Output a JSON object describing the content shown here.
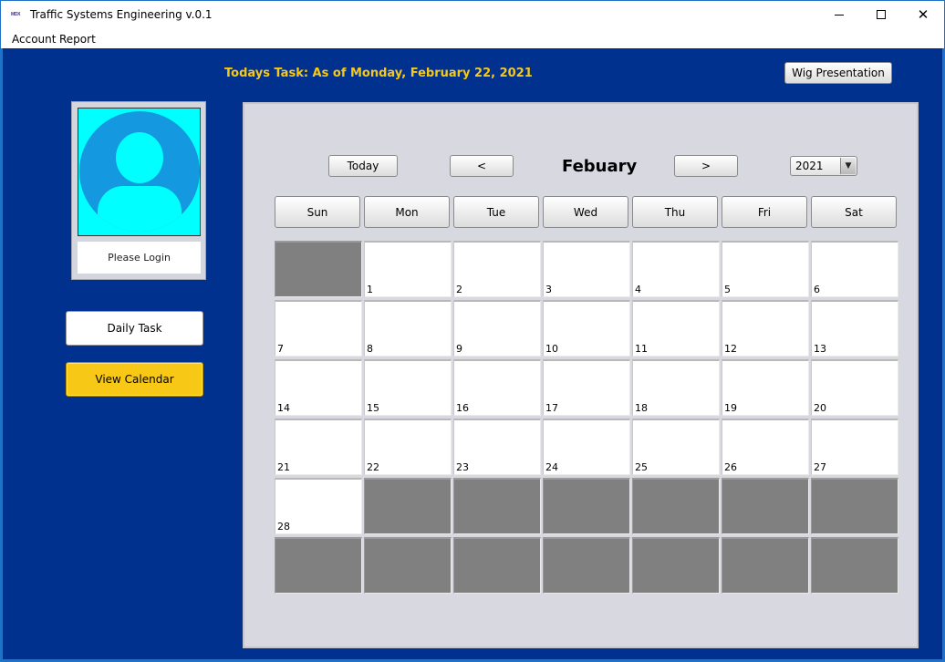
{
  "window": {
    "title": "Traffic Systems Engineering v.0.1",
    "icon_label": "MDX",
    "minimize_icon": "minimize-icon",
    "maximize_icon": "maximize-icon",
    "close_icon": "close-icon",
    "close_glyph": "✕"
  },
  "menu": {
    "items": [
      "Account",
      "Report"
    ]
  },
  "header": {
    "today_task": "Todays Task: As of Monday, February 22, 2021",
    "wig_button": "Wig Presentation"
  },
  "profile": {
    "avatar_icon": "user-avatar-icon",
    "login_text": "Please Login"
  },
  "sidebar": {
    "daily_task": "Daily Task",
    "view_calendar": "View Calendar"
  },
  "calendar": {
    "today_label": "Today",
    "prev_label": "<",
    "next_label": ">",
    "month": "Febuary",
    "year": "2021",
    "year_arrow": "▼",
    "weekdays": [
      "Sun",
      "Mon",
      "Tue",
      "Wed",
      "Thu",
      "Fri",
      "Sat"
    ],
    "days": [
      "",
      "1",
      "2",
      "3",
      "4",
      "5",
      "6",
      "7",
      "8",
      "9",
      "10",
      "11",
      "12",
      "13",
      "14",
      "15",
      "16",
      "17",
      "18",
      "19",
      "20",
      "21",
      "22",
      "23",
      "24",
      "25",
      "26",
      "27",
      "28",
      "",
      "",
      "",
      "",
      "",
      "",
      "",
      "",
      "",
      "",
      "",
      "",
      ""
    ]
  },
  "colors": {
    "background": "#01318f",
    "accent_yellow": "#f6c918",
    "calendar_panel": "#d7d8e0",
    "empty_cell": "#808080",
    "avatar_bg": "#00ffff",
    "avatar_circle": "#1499e0"
  }
}
